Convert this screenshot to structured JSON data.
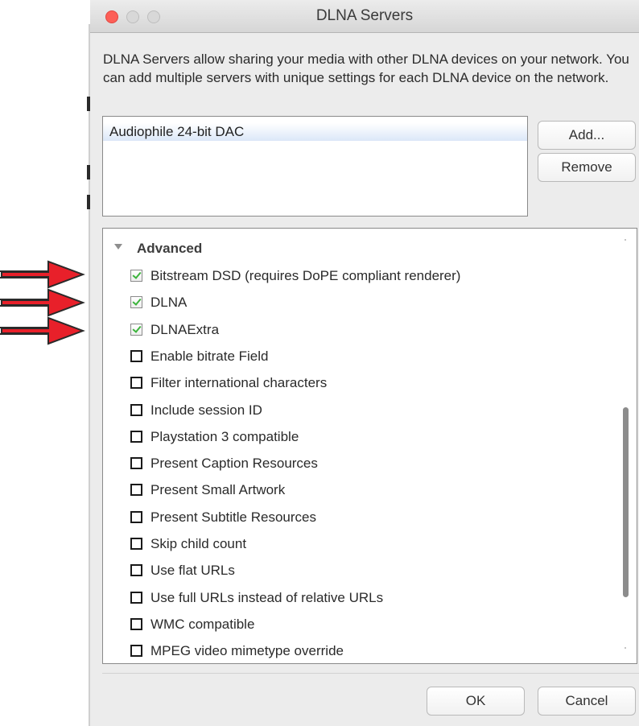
{
  "window": {
    "title": "DLNA Servers"
  },
  "description": "DLNA Servers allow sharing your media with other DLNA devices on your network.  You can add multiple servers with unique settings for each DLNA device on the network.",
  "servers": {
    "items": [
      "Audiophile 24-bit DAC"
    ],
    "selected": "Audiophile 24-bit DAC"
  },
  "buttons": {
    "add": "Add...",
    "remove": "Remove",
    "ok": "OK",
    "cancel": "Cancel"
  },
  "advanced": {
    "title": "Advanced",
    "options": [
      {
        "label": "Bitstream DSD (requires DoPE compliant renderer)",
        "checked": true
      },
      {
        "label": "DLNA",
        "checked": true
      },
      {
        "label": "DLNAExtra",
        "checked": true
      },
      {
        "label": "Enable bitrate Field",
        "checked": false
      },
      {
        "label": "Filter international characters",
        "checked": false
      },
      {
        "label": "Include session ID",
        "checked": false
      },
      {
        "label": "Playstation 3 compatible",
        "checked": false
      },
      {
        "label": "Present Caption Resources",
        "checked": false
      },
      {
        "label": "Present Small Artwork",
        "checked": false
      },
      {
        "label": "Present Subtitle Resources",
        "checked": false
      },
      {
        "label": "Skip child count",
        "checked": false
      },
      {
        "label": "Use flat URLs",
        "checked": false
      },
      {
        "label": "Use full URLs instead of relative URLs",
        "checked": false
      },
      {
        "label": "WMC compatible",
        "checked": false
      },
      {
        "label": "MPEG video mimetype override",
        "checked": false
      }
    ]
  },
  "annotations": {
    "arrow_color": "#e8202a",
    "arrow_count": 3
  },
  "colors": {
    "close": "#fd5f57",
    "checkmark": "#3cb43c",
    "selection": "#dbe7f8"
  }
}
